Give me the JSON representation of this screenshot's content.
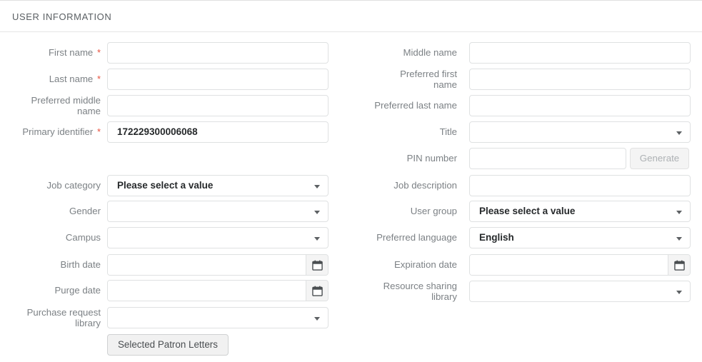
{
  "section": {
    "title": "USER INFORMATION"
  },
  "required_marker": "*",
  "colors": {
    "required_asterisk": "#e8523f",
    "label_text": "#7c8185",
    "value_text": "#26292b",
    "field_border": "#dfe1e2",
    "header_text": "#5a5f63",
    "disabled_button_text": "#adb1b4",
    "button_face": "#f1f1f1"
  },
  "left_column": {
    "fields": [
      {
        "label": "First name",
        "required": true,
        "type": "text",
        "value": "",
        "placeholder": ""
      },
      {
        "label": "Last name",
        "required": true,
        "type": "text",
        "value": "",
        "placeholder": ""
      },
      {
        "label": "Preferred middle\nname",
        "required": false,
        "type": "text",
        "value": "",
        "placeholder": ""
      },
      {
        "label": "Primary identifier",
        "required": true,
        "type": "text",
        "value": "172229300006068",
        "placeholder": ""
      },
      {
        "label": "Job category",
        "required": false,
        "type": "select",
        "value": "Please select a value",
        "placeholder": ""
      },
      {
        "label": "Gender",
        "required": false,
        "type": "select",
        "value": "",
        "placeholder": ""
      },
      {
        "label": "Campus",
        "required": false,
        "type": "select",
        "value": "",
        "placeholder": ""
      },
      {
        "label": "Birth date",
        "required": false,
        "type": "date",
        "value": "",
        "placeholder": ""
      },
      {
        "label": "Purge date",
        "required": false,
        "type": "date",
        "value": "",
        "placeholder": ""
      },
      {
        "label": "Purchase request\nlibrary",
        "required": false,
        "type": "select",
        "value": "",
        "placeholder": ""
      }
    ],
    "action_button": {
      "label": "Selected Patron Letters",
      "enabled": true
    }
  },
  "right_column": {
    "fields": [
      {
        "label": "Middle name",
        "required": false,
        "type": "text",
        "value": "",
        "placeholder": ""
      },
      {
        "label": "Preferred first\nname",
        "required": false,
        "type": "text",
        "value": "",
        "placeholder": ""
      },
      {
        "label": "Preferred last name",
        "required": false,
        "type": "text",
        "value": "",
        "placeholder": ""
      },
      {
        "label": "Title",
        "required": false,
        "type": "select",
        "value": "",
        "placeholder": ""
      },
      {
        "label": "PIN number",
        "required": false,
        "type": "text_with_button",
        "value": "",
        "placeholder": "",
        "button_label": "Generate",
        "button_enabled": false
      },
      {
        "label": "Job description",
        "required": false,
        "type": "text",
        "value": "",
        "placeholder": ""
      },
      {
        "label": "User group",
        "required": false,
        "type": "select",
        "value": "Please select a value",
        "placeholder": ""
      },
      {
        "label": "Preferred language",
        "required": false,
        "type": "select",
        "value": "English",
        "placeholder": ""
      },
      {
        "label": "Expiration date",
        "required": false,
        "type": "date",
        "value": "",
        "placeholder": ""
      },
      {
        "label": "Resource sharing\nlibrary",
        "required": false,
        "type": "select",
        "value": "",
        "placeholder": ""
      }
    ]
  },
  "icons": {
    "calendar": "calendar-icon",
    "dropdown": "chevron-down-icon"
  }
}
